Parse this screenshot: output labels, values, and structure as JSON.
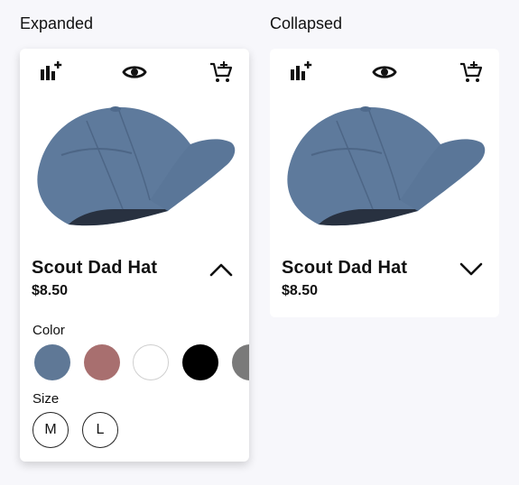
{
  "sections": {
    "expanded_title": "Expanded",
    "collapsed_title": "Collapsed"
  },
  "product": {
    "name": "Scout Dad Hat",
    "price": "$8.50"
  },
  "card_icons": [
    "compare-add-icon",
    "eye-icon",
    "add-to-cart-icon"
  ],
  "options": {
    "color_label": "Color",
    "size_label": "Size",
    "colors": [
      "#5f7896",
      "#a86f6f",
      "#ffffff",
      "#000000",
      "#7a7a7a"
    ],
    "sizes": [
      "M",
      "L"
    ]
  },
  "colors": {
    "background": "#f7f7fb",
    "card": "#ffffff",
    "hat": "#5f7a9c",
    "text": "#111111"
  }
}
